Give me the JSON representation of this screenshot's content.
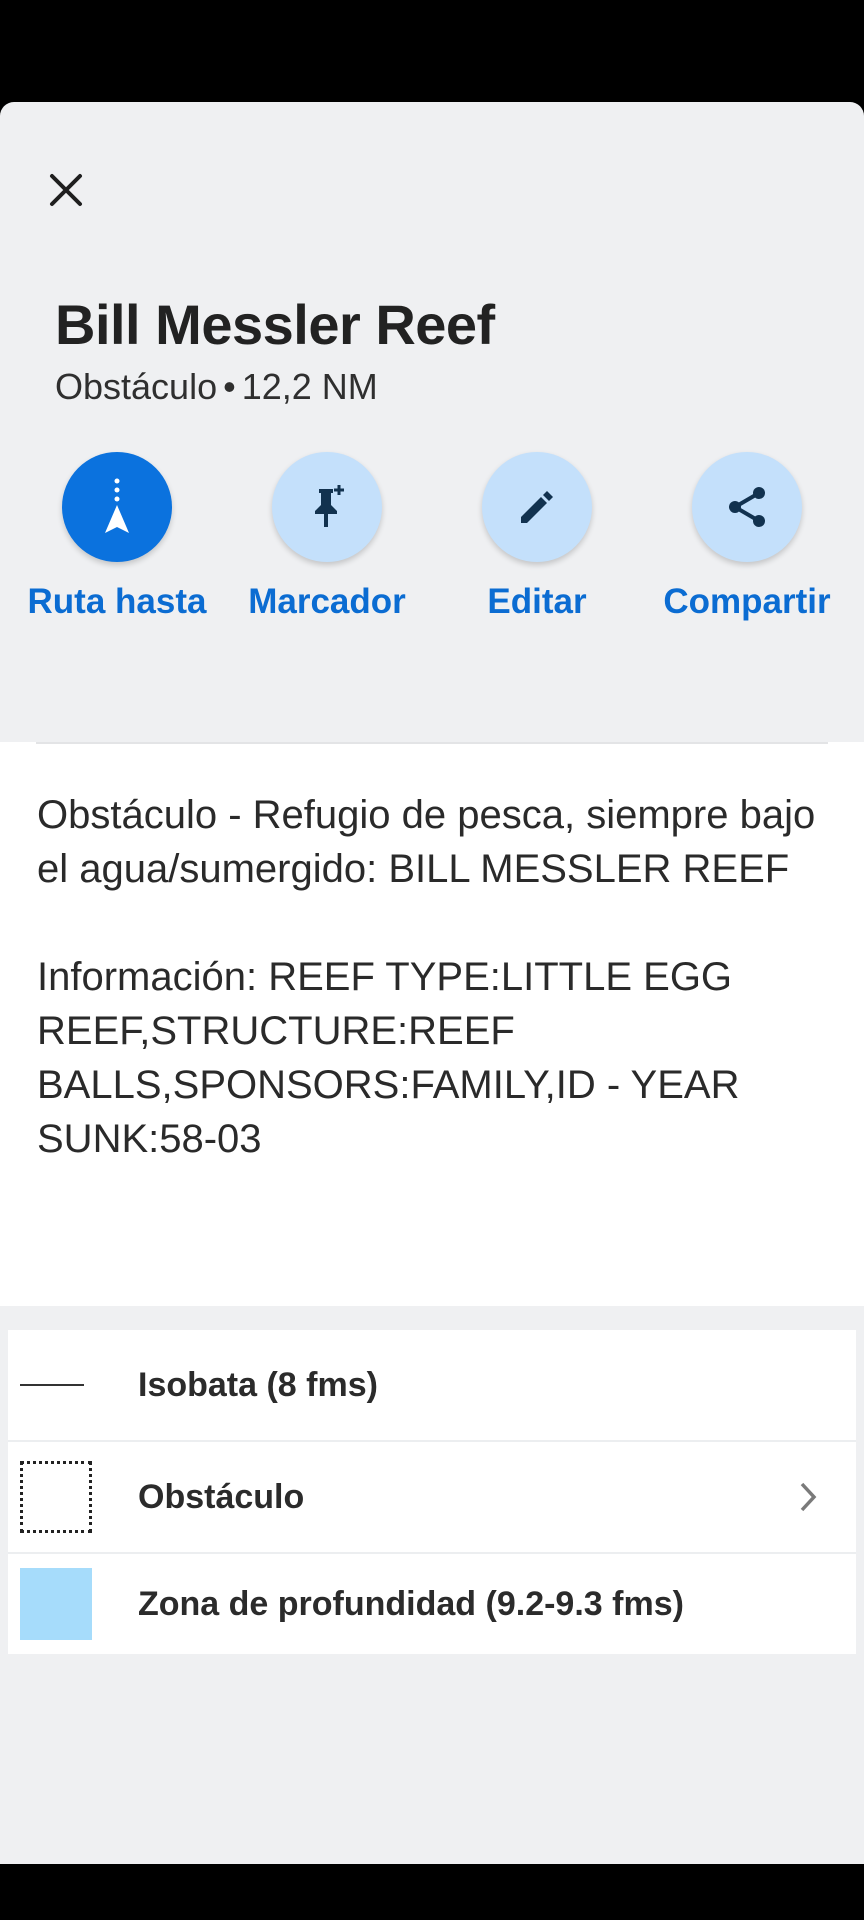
{
  "colors": {
    "primary": "#0b72de",
    "action_bg": "#c4e0fb",
    "depth_area": "#a6dcfb"
  },
  "header": {
    "title": "Bill Messler Reef",
    "type": "Obstáculo",
    "separator": "•",
    "distance": "12,2 NM"
  },
  "actions": [
    {
      "label": "Ruta hasta",
      "icon": "route-to-icon"
    },
    {
      "label": "Marcador",
      "icon": "pin-add-icon"
    },
    {
      "label": "Editar",
      "icon": "pencil-icon"
    },
    {
      "label": "Compartir",
      "icon": "share-icon"
    }
  ],
  "description": {
    "paragraph1": "Obstáculo - Refugio de pesca, siempre bajo el agua/sumergido: BILL MESSLER REEF",
    "paragraph2": "Información: REEF TYPE:LITTLE EGG REEF,STRUCTURE:REEF BALLS,SPONSORS:FAMILY,ID - YEAR SUNK:58-03"
  },
  "legend": [
    {
      "label": "Isobata  (8 fms)",
      "symbol": "solid-line"
    },
    {
      "label": "Obstáculo",
      "symbol": "dotted-square"
    },
    {
      "label": "Zona de profundidad (9.2-9.3 fms)",
      "symbol": "light-blue-area"
    }
  ]
}
